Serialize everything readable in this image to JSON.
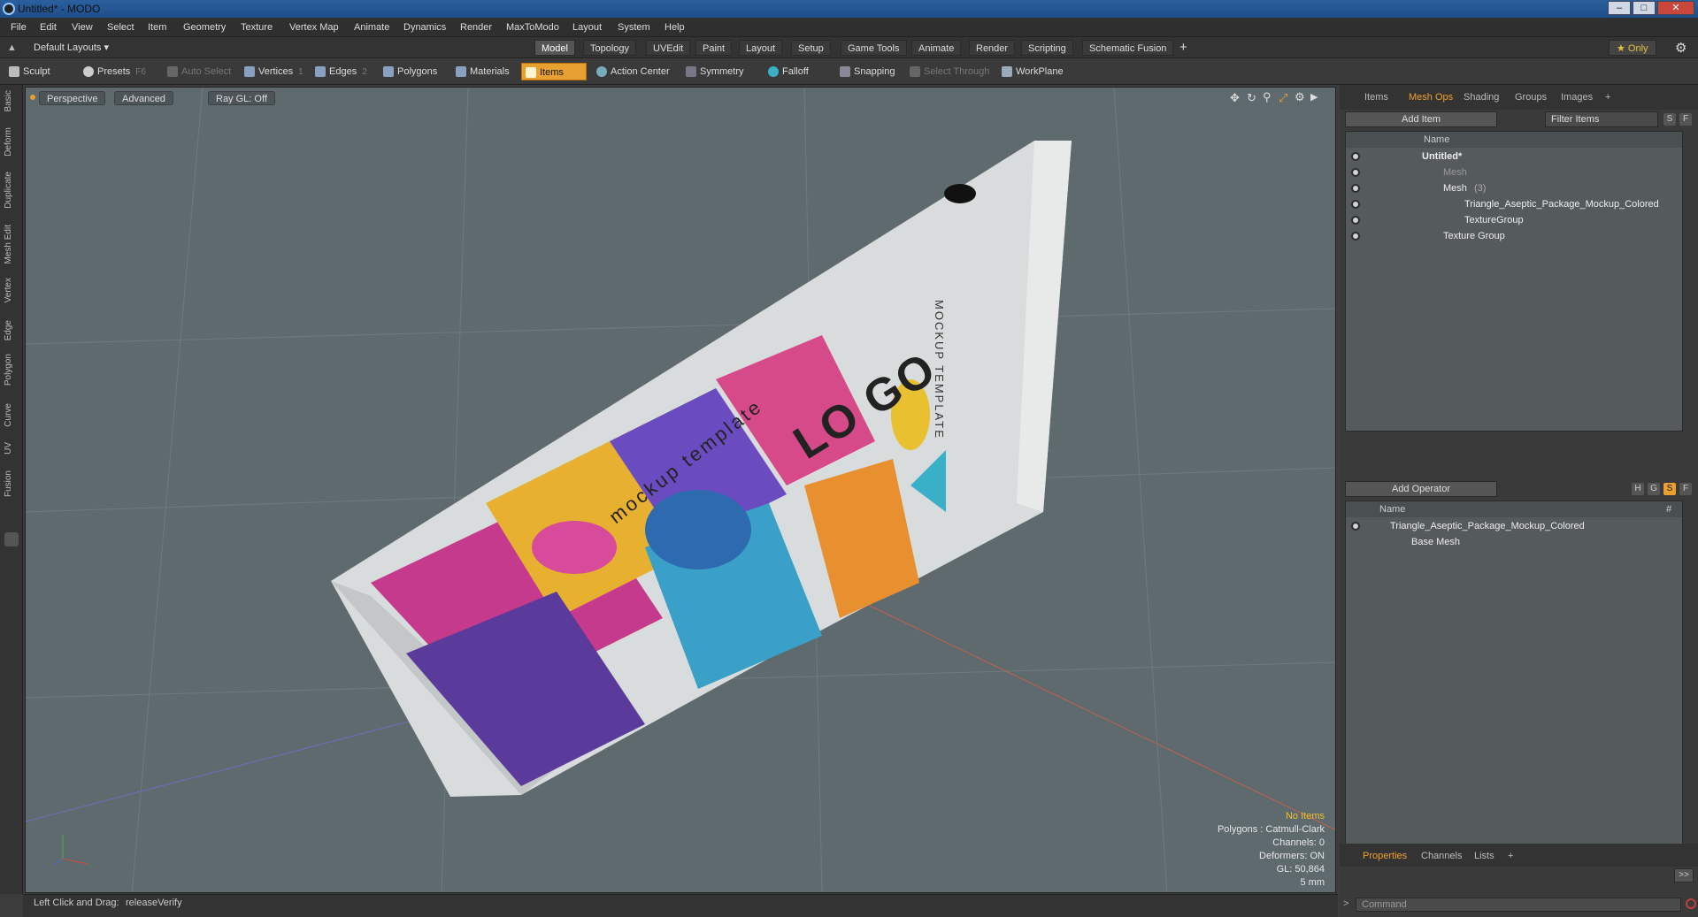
{
  "window": {
    "title": "Untitled* - MODO",
    "minimize": "–",
    "maximize": "□",
    "close": "✕"
  },
  "menu": [
    "File",
    "Edit",
    "View",
    "Select",
    "Item",
    "Geometry",
    "Texture",
    "Vertex Map",
    "Animate",
    "Dynamics",
    "Render",
    "MaxToModo",
    "Layout",
    "System",
    "Help"
  ],
  "layout": {
    "selector": "Default Layouts ▾",
    "tabs": [
      "Model",
      "Topology",
      "UVEdit",
      "Paint",
      "Layout",
      "Setup",
      "Game Tools",
      "Animate",
      "Render",
      "Scripting",
      "Schematic Fusion"
    ],
    "active_tab": "Model",
    "add": "+",
    "only": "★ Only",
    "gear": "⚙"
  },
  "toolbar": {
    "sculpt": "Sculpt",
    "presets": "Presets",
    "presets_key": "F6",
    "auto_select": "Auto Select",
    "vertices": "Vertices",
    "vertices_key": "1",
    "edges": "Edges",
    "edges_key": "2",
    "polygons": "Polygons",
    "materials": "Materials",
    "items": "Items",
    "action_center": "Action Center",
    "symmetry": "Symmetry",
    "falloff": "Falloff",
    "snapping": "Snapping",
    "select_through": "Select Through",
    "workplane": "WorkPlane"
  },
  "left_tabs": [
    "Basic",
    "Deform",
    "Duplicate",
    "Mesh Edit",
    "Vertex",
    "Edge",
    "Polygon",
    "Curve",
    "UV",
    "Fusion"
  ],
  "viewport": {
    "view": "Perspective",
    "shading": "Advanced",
    "raygl": "Ray GL: Off",
    "logo_text": "LO GO",
    "mockup_text": "mockup template",
    "mockup_caps": "MOCKUP TEMPLATE",
    "info": [
      "No Items",
      "Polygons : Catmull-Clark",
      "Channels: 0",
      "Deformers: ON",
      "GL: 50,864",
      "5 mm"
    ]
  },
  "status": {
    "hint_label": "Left Click and Drag:",
    "hint_value": "releaseVerify"
  },
  "items_panel": {
    "tabs": [
      "Items",
      "Mesh Ops",
      "Shading",
      "Groups",
      "Images"
    ],
    "active_tab": "Mesh Ops",
    "add_item": "Add Item",
    "filter": "Filter Items",
    "s": "S",
    "f": "F",
    "col_name": "Name",
    "tree": [
      {
        "label": "Untitled*",
        "indent": 0
      },
      {
        "label": "Mesh",
        "indent": 1
      },
      {
        "label": "Mesh",
        "count": "(3)",
        "indent": 1
      },
      {
        "label": "Triangle_Aseptic_Package_Mockup_Colored",
        "indent": 2
      },
      {
        "label": "TextureGroup",
        "indent": 2
      },
      {
        "label": "Texture Group",
        "indent": 1
      }
    ]
  },
  "meshops_panel": {
    "add_operator": "Add Operator",
    "h": "H",
    "g": "G",
    "s": "S",
    "f": "F",
    "col_name": "Name",
    "col_hash": "#",
    "tree": [
      {
        "label": "Triangle_Aseptic_Package_Mockup_Colored"
      },
      {
        "label": "Base Mesh"
      }
    ]
  },
  "properties_panel": {
    "tabs": [
      "Properties",
      "Channels",
      "Lists"
    ],
    "active_tab": "Properties",
    "add": "+",
    "expand": ">>",
    "command_placeholder": "Command"
  },
  "colors": {
    "accent": "#e8a030",
    "viewport_bg": "#5f6a6e",
    "panel_bg": "#3a3a3a"
  }
}
